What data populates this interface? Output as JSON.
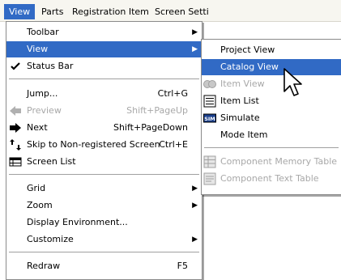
{
  "menubar": {
    "items": [
      "View",
      "Parts",
      "Registration Item",
      "Screen Setti"
    ]
  },
  "view_menu": {
    "toolbar": "Toolbar",
    "view": "View",
    "status_bar": "Status Bar",
    "jump": "Jump...",
    "jump_shortcut": "Ctrl+G",
    "preview": "Preview",
    "preview_shortcut": "Shift+PageUp",
    "next": "Next",
    "next_shortcut": "Shift+PageDown",
    "skip": "Skip to Non-registered Screen",
    "skip_shortcut": "Ctrl+E",
    "screen_list": "Screen List",
    "grid": "Grid",
    "zoom": "Zoom",
    "display_environment": "Display Environment...",
    "customize": "Customize",
    "redraw": "Redraw",
    "redraw_shortcut": "F5"
  },
  "view_submenu": {
    "project_view": "Project View",
    "catalog_view": "Catalog View",
    "item_view": "Item View",
    "item_list": "Item List",
    "simulate": "Simulate",
    "mode_item": "Mode Item",
    "component_memory_table": "Component Memory Table",
    "component_text_table": "Component Text Table"
  },
  "icons": {
    "checkmark": "check-icon",
    "preview": "left-arrow-icon",
    "next": "right-arrow-icon",
    "skip": "skip-arrows-icon",
    "screen_list": "screen-list-icon",
    "item_view": "item-view-icon",
    "item_list": "item-list-icon",
    "simulate": "simulate-icon",
    "memory_table": "memory-table-icon",
    "text_table": "text-table-icon"
  },
  "colors": {
    "highlight": "#316ac5",
    "disabled_text": "#a8a8a8",
    "menubar_bg": "#f7f6f0"
  }
}
